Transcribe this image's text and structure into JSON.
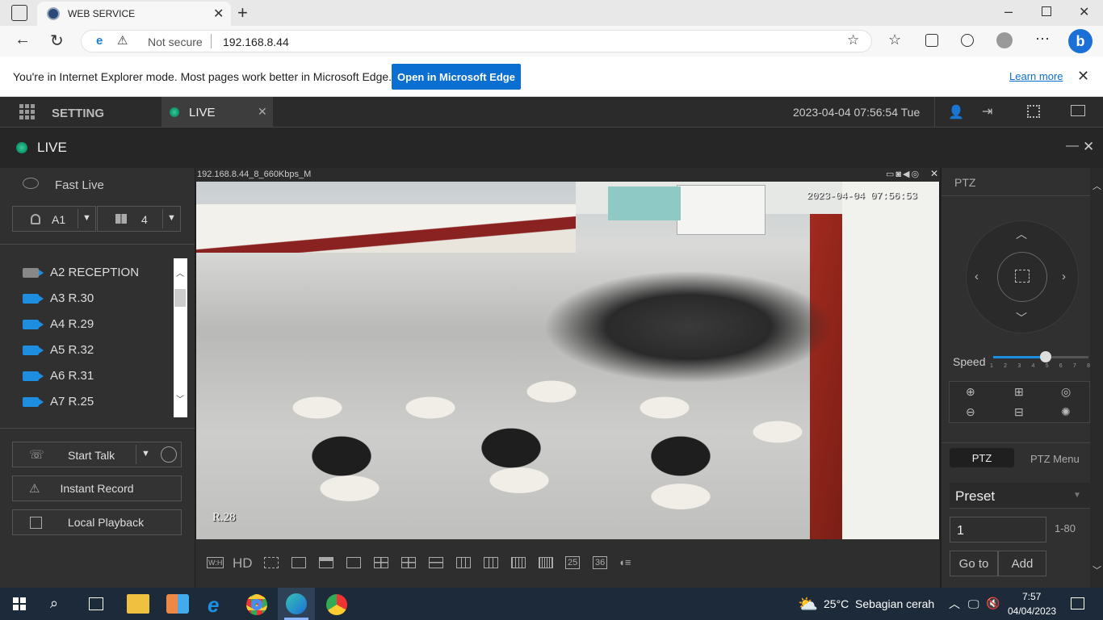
{
  "browser": {
    "tab_title": "WEB SERVICE",
    "security_label": "Not secure",
    "url": "192.168.8.44",
    "ie_notice": "You're in Internet Explorer mode. Most pages work better in Microsoft Edge.",
    "open_edge_label": "Open in Microsoft Edge",
    "learn_more_label": "Learn more"
  },
  "app": {
    "setting_label": "SETTING",
    "live_tab_label": "LIVE",
    "datetime": "2023-04-04 07:56:54 Tue",
    "panel_title": "LIVE"
  },
  "left": {
    "fast_live_label": "Fast Live",
    "area_select": "A1",
    "layout_select": "4",
    "cameras": [
      "A2 RECEPTION",
      "A3 R.30",
      "A4 R.29",
      "A5 R.32",
      "A6 R.31",
      "A7 R.25"
    ],
    "start_talk_label": "Start Talk",
    "instant_record_label": "Instant Record",
    "local_playback_label": "Local Playback"
  },
  "video": {
    "stream_info": "192.168.8.44_8_660Kbps_M",
    "overlay_timestamp": "2023-04-04 07:56:53",
    "room_label": "R.28",
    "toolbar": {
      "wh": "W:H",
      "hd": "HD",
      "n25": "25",
      "n36": "36"
    }
  },
  "ptz": {
    "title": "PTZ",
    "speed_label": "Speed",
    "speed_value": 5,
    "speed_ticks": [
      "1",
      "2",
      "3",
      "4",
      "5",
      "6",
      "7",
      "8"
    ],
    "tab_ptz": "PTZ",
    "tab_menu": "PTZ Menu",
    "preset_label": "Preset",
    "preset_value": "1",
    "preset_range": "1-80",
    "goto_label": "Go to",
    "add_label": "Add"
  },
  "taskbar": {
    "weather": "25°C  Sebagian cerah",
    "time": "7:57",
    "date": "04/04/2023"
  },
  "colors": {
    "accent": "#0a6fd1",
    "camera_blue": "#1e8fe0"
  }
}
